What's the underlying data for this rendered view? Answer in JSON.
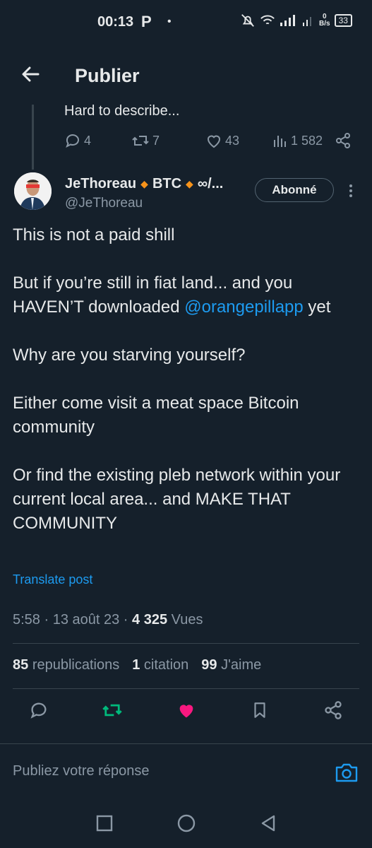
{
  "status_bar": {
    "time": "00:13",
    "app_letter": "P",
    "dot": "•",
    "net_speed": "0",
    "net_unit": "B/s",
    "battery": "33"
  },
  "header": {
    "title": "Publier",
    "back_icon": "arrow-left-icon"
  },
  "previous_post": {
    "text": "Hard to describe...",
    "replies": "4",
    "reposts": "7",
    "likes": "43",
    "views": "1 582"
  },
  "post": {
    "author_name": "JeThoreau",
    "author_tag": "BTC",
    "author_extra": "∞/...",
    "handle": "@JeThoreau",
    "follow_label": "Abonné",
    "p1": "This is not a paid shill",
    "p2_before": "But if you’re still in fiat land... and you HAVEN’T downloaded ",
    "p2_mention": "@orangepillapp",
    "p2_after": " yet",
    "p3": "Why are you starving yourself?",
    "p4": "Either come visit a meat space Bitcoin community",
    "p5": "Or find the existing pleb network within your current local area... and MAKE THAT COMMUNITY",
    "translate": "Translate post",
    "time": "5:58",
    "sep1": " · ",
    "date": "13 août 23",
    "sep2": " · ",
    "views_count": "4 325",
    "views_label": " Vues",
    "reposts_count": "85",
    "reposts_label": "republications",
    "quotes_count": "1",
    "quotes_label": "citation",
    "likes_count": "99",
    "likes_label": "J'aime"
  },
  "reply": {
    "placeholder": "Publiez votre réponse"
  },
  "colors": {
    "accent": "#1d9bf0",
    "like": "#f91880",
    "repost": "#00ba7c",
    "background": "#15202b"
  }
}
